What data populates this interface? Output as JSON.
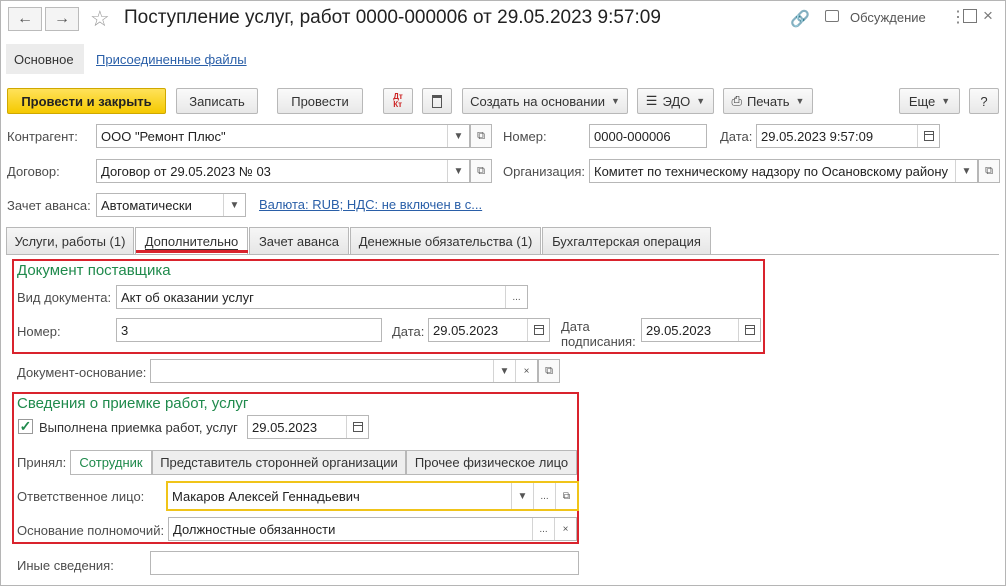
{
  "window": {
    "title": "Поступление услуг, работ 0000-000006 от 29.05.2023 9:57:09",
    "discussion": "Обсуждение"
  },
  "sections": {
    "main": "Основное",
    "files": "Присоединенные файлы"
  },
  "toolbar": {
    "post_close": "Провести и закрыть",
    "save": "Записать",
    "post": "Провести",
    "create_based": "Создать на основании",
    "edo": "ЭДО",
    "print": "Печать",
    "more": "Еще",
    "help": "?"
  },
  "header": {
    "counterparty_label": "Контрагент:",
    "counterparty_value": "ООО \"Ремонт Плюс\"",
    "contract_label": "Договор:",
    "contract_value": "Договор от 29.05.2023 № 03",
    "advance_label": "Зачет аванса:",
    "advance_value": "Автоматически",
    "currency_link": "Валюта: RUB; НДС: не включен в с...",
    "number_label": "Номер:",
    "number_value": "0000-000006",
    "date_label": "Дата:",
    "date_value": "29.05.2023  9:57:09",
    "org_label": "Организация:",
    "org_value": "Комитет по техническому надзору по Осановскому району"
  },
  "tabs": [
    {
      "label": "Услуги, работы (1)"
    },
    {
      "label": "Дополнительно"
    },
    {
      "label": "Зачет аванса"
    },
    {
      "label": "Денежные обязательства (1)"
    },
    {
      "label": "Бухгалтерская операция"
    }
  ],
  "supplier_doc": {
    "title": "Документ поставщика",
    "doc_type_label": "Вид документа:",
    "doc_type_value": "Акт об оказании услуг",
    "number_label": "Номер:",
    "number_value": "3",
    "date_label": "Дата:",
    "date_value": "29.05.2023",
    "sign_date_label_1": "Дата",
    "sign_date_label_2": "подписания:",
    "sign_date_value": "29.05.2023"
  },
  "basis_doc": {
    "label": "Документ-основание:",
    "value": ""
  },
  "acceptance": {
    "title": "Сведения о приемке работ, услуг",
    "checkbox_label": "Выполнена приемка работ, услуг",
    "checked": true,
    "date_value": "29.05.2023",
    "accepted_label": "Принял:",
    "accepted_tabs": [
      "Сотрудник",
      "Представитель сторонней организации",
      "Прочее физическое лицо"
    ],
    "responsible_label": "Ответственное лицо:",
    "responsible_value": "Макаров Алексей Геннадьевич",
    "authority_label": "Основание полномочий:",
    "authority_value": "Должностные обязанности"
  },
  "other": {
    "label": "Иные сведения:",
    "value": ""
  }
}
